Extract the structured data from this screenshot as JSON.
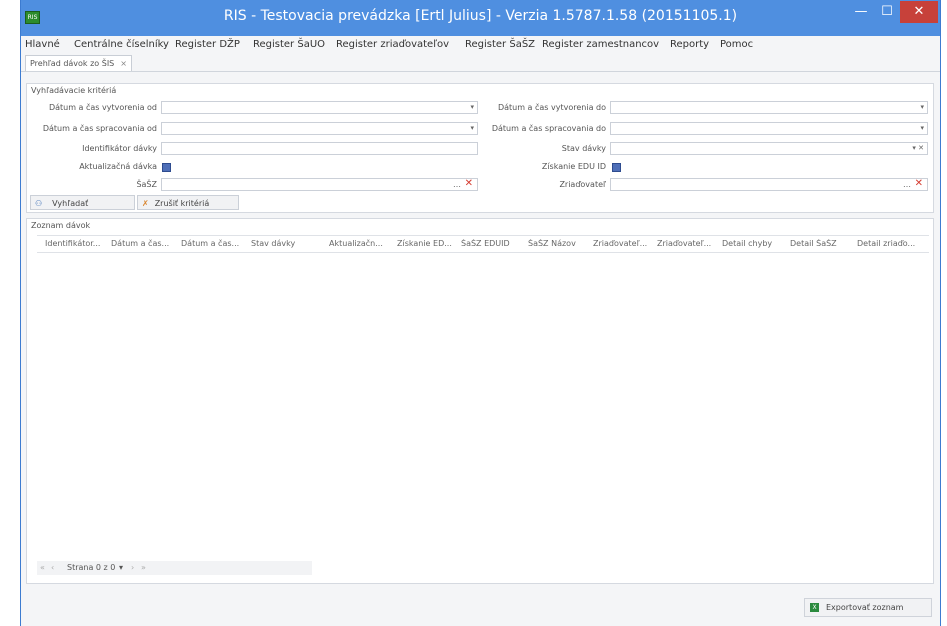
{
  "window": {
    "title": "RIS - Testovacia prevádzka [Ertl Julius] - Verzia 1.5787.1.58 (20151105.1)",
    "min_icon": "—",
    "max_icon": "☐",
    "close_icon": "✕"
  },
  "menu": [
    "Hlavné",
    "Centrálne číselníky",
    "Register DŽP",
    "Register ŠaUO",
    "Register zriaďovateľov",
    "Register ŠaŠZ",
    "Register zamestnancov",
    "Reporty",
    "Pomoc"
  ],
  "tab": {
    "label": "Prehľad dávok zo ŠIS",
    "close": "×"
  },
  "filters": {
    "title": "Vyhľadávacie kritériá",
    "created_from": "Dátum a čas vytvorenia od",
    "created_to": "Dátum a čas vytvorenia do",
    "processed_from": "Dátum a čas spracovania od",
    "processed_to": "Dátum a čas spracovania do",
    "batch_id": "Identifikátor dávky",
    "batch_status": "Stav dávky",
    "update_batch": "Aktualizačná dávka",
    "edu_id": "Získanie EDU ID",
    "sasz": "ŠaŠZ",
    "founder": "Zriaďovateľ",
    "search_button": "Vyhľadať",
    "clear_button": "Zrušiť kritériá"
  },
  "list": {
    "title": "Zoznam dávok",
    "columns": [
      "Identifikátor...",
      "Dátum a čas...",
      "Dátum a čas...",
      "Stav dávky",
      "Aktualizačn...",
      "Získanie ED...",
      "ŠaŠZ EDUID",
      "ŠaŠZ Názov",
      "Zriaďovateľ...",
      "Zriaďovateľ...",
      "Detail chyby",
      "Detail ŠaŠZ",
      "Detail zriaďo..."
    ],
    "pager_text": "Strana 0 z 0"
  },
  "export_button": "Exportovať zoznam",
  "colors": {
    "titlebar": "#4f8fe0",
    "close": "#c7413a",
    "clear_x": "#d43a2f"
  }
}
